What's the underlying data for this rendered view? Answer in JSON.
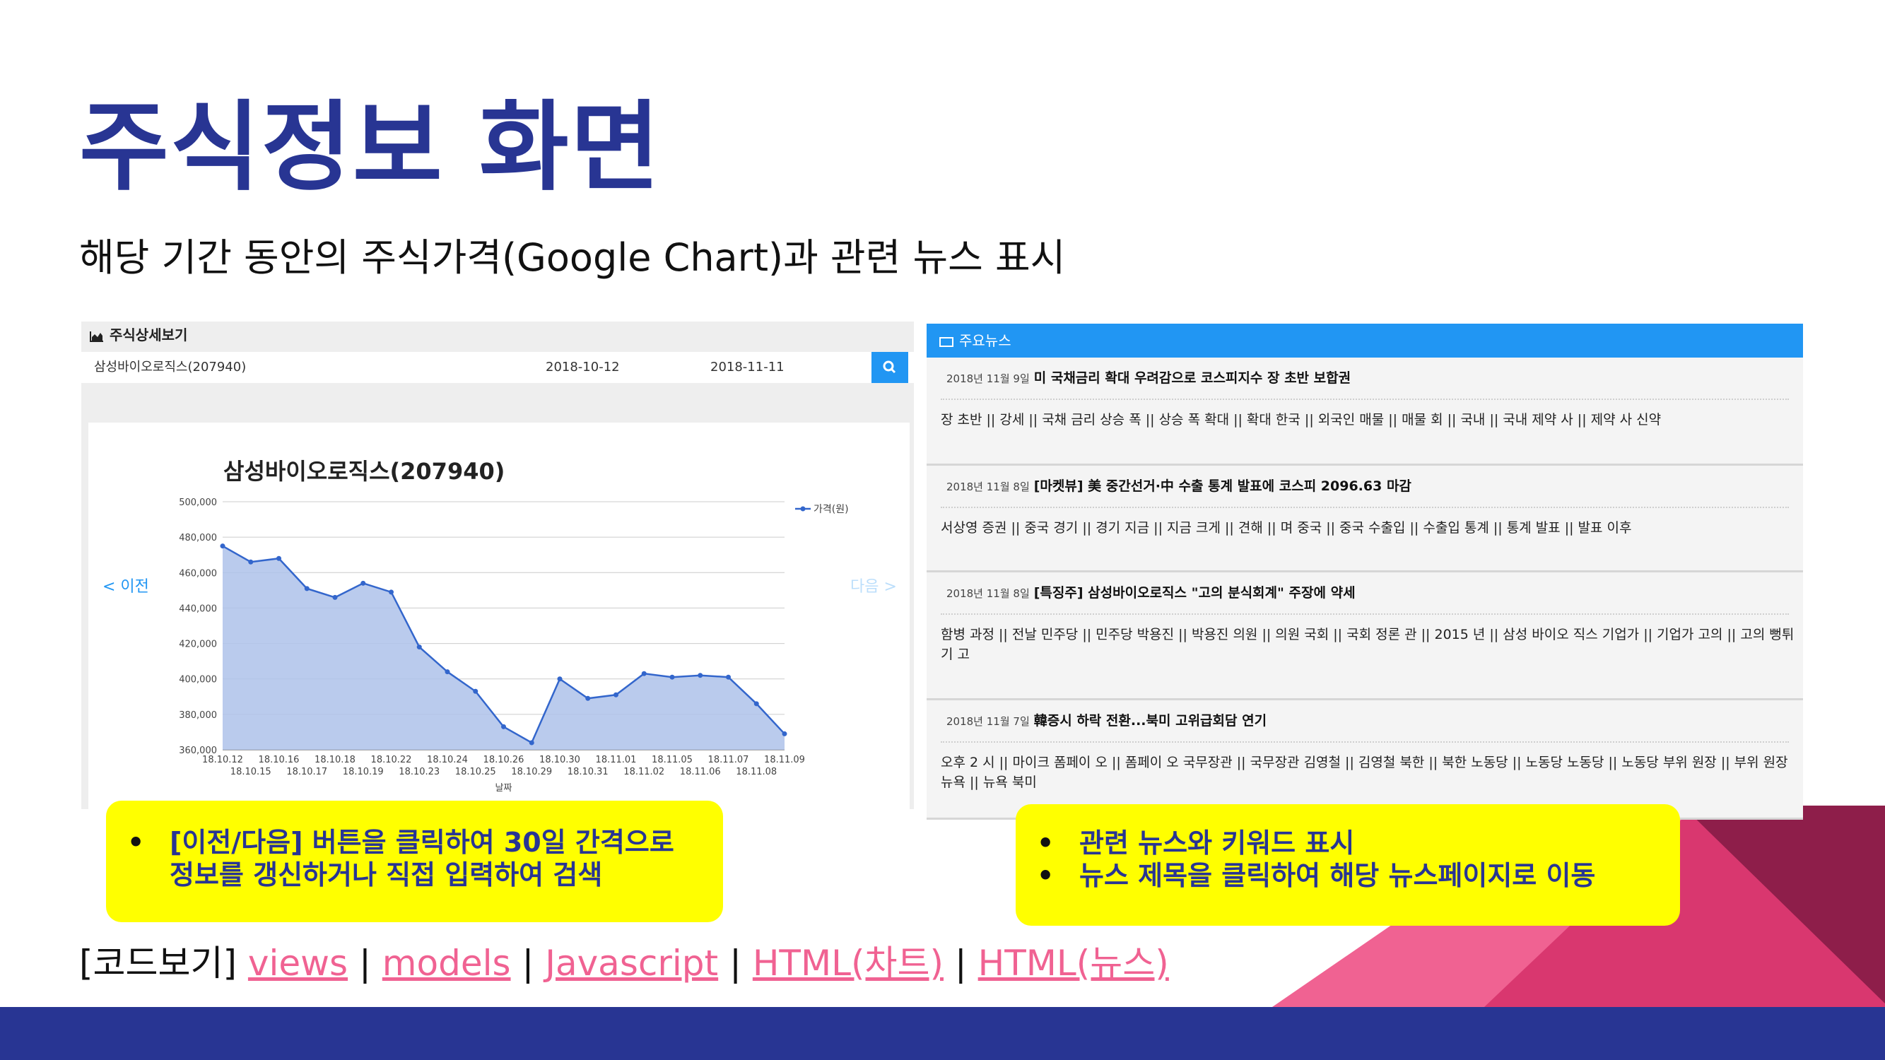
{
  "slide": {
    "title": "주식정보 화면",
    "subtitle": "해당 기간 동안의 주식가격(Google Chart)과 관련 뉴스 표시"
  },
  "stock_panel": {
    "header": "주식상세보기",
    "header_icon": "area-chart-icon",
    "search": {
      "stock_value": "삼성바이오로직스(207940)",
      "start_date": "2018-10-12",
      "end_date": "2018-11-11",
      "button_icon": "search-icon"
    },
    "prev_label": "< 이전",
    "next_label": "다음 >"
  },
  "chart_data": {
    "type": "area",
    "title": "삼성바이오로직스(207940)",
    "xlabel": "날짜",
    "ylabel": "",
    "legend": {
      "position": "top-right",
      "entry": "가격(원)"
    },
    "grid": true,
    "ylim": [
      360000,
      500000
    ],
    "yticks": [
      "500,000",
      "480,000",
      "460,000",
      "440,000",
      "420,000",
      "400,000",
      "380,000",
      "360,000"
    ],
    "categories": [
      "18.10.12",
      "18.10.15",
      "18.10.16",
      "18.10.17",
      "18.10.18",
      "18.10.19",
      "18.10.22",
      "18.10.23",
      "18.10.24",
      "18.10.25",
      "18.10.26",
      "18.10.29",
      "18.10.30",
      "18.10.31",
      "18.11.01",
      "18.11.02",
      "18.11.05",
      "18.11.06",
      "18.11.07",
      "18.11.08",
      "18.11.09"
    ],
    "series": [
      {
        "name": "가격(원)",
        "color": "#3366cc",
        "values": [
          475000,
          466000,
          468000,
          451000,
          446000,
          454000,
          449000,
          418000,
          404000,
          393000,
          373000,
          364000,
          400000,
          389000,
          391000,
          403000,
          401000,
          402000,
          401000,
          386000,
          369000
        ]
      }
    ]
  },
  "news_panel": {
    "header": "주요뉴스",
    "header_icon": "newspaper-icon",
    "items": [
      {
        "date": "2018년 11월 9일",
        "title": "미 국채금리 확대 우려감으로 코스피지수 장 초반 보합권",
        "keywords": "장 초반 || 강세 || 국채 금리 상승 폭 || 상승 폭 확대 || 확대 한국 || 외국인 매물 || 매물 회 || 국내 || 국내 제약 사 || 제약 사 신약"
      },
      {
        "date": "2018년 11월 8일",
        "title": "[마켓뷰] 美 중간선거·中 수출 통계 발표에 코스피 2096.63 마감",
        "keywords": "서상영 증권 || 중국 경기 || 경기 지금 || 지금 크게 || 견해 || 며 중국 || 중국 수출입 || 수출입 통계 || 통계 발표 || 발표 이후"
      },
      {
        "date": "2018년 11월 8일",
        "title": "[특징주] 삼성바이오로직스 \"고의 분식회계\" 주장에 약세",
        "keywords": "함병 과정 || 전날 민주당 || 민주당 박용진 || 박용진 의원 || 의원 국회 || 국회 정론 관 || 2015 년 || 삼성 바이오 직스 기업가 || 기업가 고의 || 고의 뻥튀기 고"
      },
      {
        "date": "2018년 11월 7일",
        "title": "韓증시 하락 전환...북미 고위급회담 연기",
        "keywords": "오후 2 시 || 마이크 폼페이 오 || 폼페이 오 국무장관 || 국무장관 김영철 || 김영철 북한 || 북한 노동당 || 노동당 노동당 || 노동당 부위 원장 || 부위 원장 뉴욕 || 뉴욕 북미"
      }
    ]
  },
  "callouts": {
    "left": {
      "line1": "[이전/다음] 버튼을 클릭하여 30일 간격으로",
      "line2": "정보를 갱신하거나 직접 입력하여 검색"
    },
    "right": {
      "line1": "관련 뉴스와 키워드 표시",
      "line2": "뉴스 제목을 클릭하여 해당 뉴스페이지로 이동"
    }
  },
  "code_links": {
    "prefix": "[코드보기]",
    "sep": "|",
    "links": [
      "views",
      "models",
      "Javascript",
      "HTML(차트)",
      "HTML(뉴스)"
    ]
  },
  "colors": {
    "title": "#283593",
    "accent_blue": "#2196f3",
    "callout": "#ffff00",
    "link": "#f06292",
    "deco_pink": "#f06292",
    "deco_magenta": "#c2185b",
    "deco_maroon": "#8e1e4a",
    "bottom_bar": "#283593"
  }
}
